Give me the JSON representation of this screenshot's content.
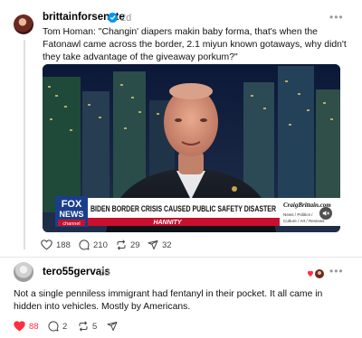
{
  "post": {
    "username": "brittainforsenate",
    "time": "2d",
    "more": "•••",
    "caption": "Tom Homan: \"Changin' diapers makin baby forma, that's when the Fatonawl came across the border, 2.1 miyun known gotaways, why didn't they take advantage of the giveaway porkum?\"",
    "media": {
      "network_line1": "FOX",
      "network_line2": "NEWS",
      "network_line3": "channel",
      "headline": "BIDEN BORDER CRISIS CAUSED PUBLIC SAFETY DISASTER",
      "show": "HANNITY",
      "watermark_site": "CraigBrittain.com",
      "watermark_tags": [
        "News / Politics /",
        "Culture / Art / Reviews"
      ]
    },
    "stats": {
      "likes": "188",
      "replies": "210",
      "reposts": "29",
      "shares": "32"
    },
    "icons": [
      "heart-icon",
      "comment-icon",
      "repost-icon",
      "share-icon",
      "verified-badge-icon",
      "mute-icon"
    ]
  },
  "reply": {
    "username": "tero55gervais",
    "time": "2d",
    "more": "•••",
    "text": "Not a single penniless immigrant had fentanyl in their pocket. It all came in hidden into vehicles. Mostly by Americans.",
    "stats": {
      "likes": "88",
      "replies": "2",
      "reposts": "5"
    },
    "liked": true
  },
  "colors": {
    "accent": "#0095f6",
    "like": "#ff3040",
    "muted_text": "#999999",
    "fox_blue": "#1a3e8c",
    "fox_red": "#c8102e"
  }
}
